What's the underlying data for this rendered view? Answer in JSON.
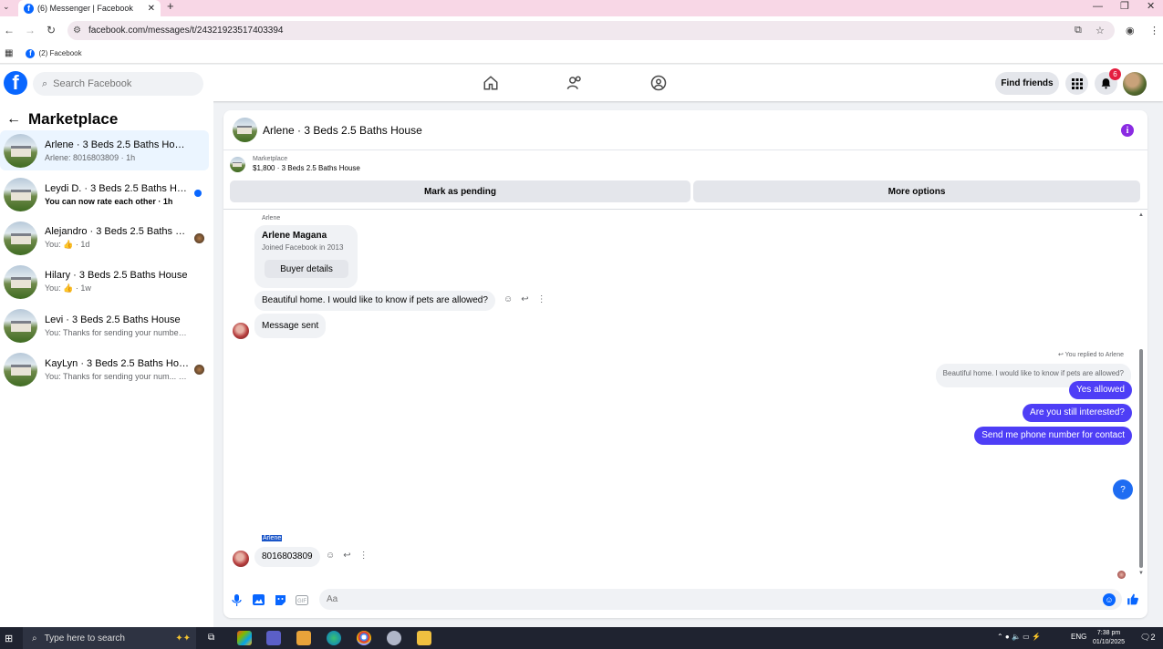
{
  "browser": {
    "tab_title": "(6) Messenger | Facebook",
    "url": "facebook.com/messages/t/24321923517403394",
    "bookmark": "(2) Facebook"
  },
  "header": {
    "search_placeholder": "Search Facebook",
    "find_friends": "Find friends",
    "notification_count": "6"
  },
  "sidebar": {
    "title": "Marketplace",
    "conversations": [
      {
        "name": "Arlene · 3 Beds 2.5 Baths House",
        "sub": "Arlene: 8016803809 · 1h",
        "active": true
      },
      {
        "name": "Leydi D. · 3 Beds 2.5 Baths House",
        "sub": "You can now rate each other · 1h",
        "unread": true
      },
      {
        "name": "Alejandro · 3 Beds 2.5 Baths Ho...",
        "sub": "You: 👍 · 1d"
      },
      {
        "name": "Hilary · 3 Beds 2.5 Baths House",
        "sub": "You: 👍 · 1w"
      },
      {
        "name": "Levi · 3 Beds 2.5 Baths House",
        "sub": "You: Thanks for sending your number,... · 1w"
      },
      {
        "name": "KayLyn · 3 Beds 2.5 Baths House",
        "sub": "You: Thanks for sending your num... · 1w"
      }
    ]
  },
  "chat": {
    "title": "Arlene · 3 Beds 2.5 Baths House",
    "listing_category": "Marketplace",
    "listing_line": "$1,800 · 3 Beds 2.5 Baths House",
    "mark_pending": "Mark as pending",
    "more_options": "More options",
    "sender": "Arlene",
    "card_name": "Arlene Magana",
    "card_sub": "Joined Facebook in 2013",
    "buyer_details": "Buyer details",
    "msg1": "Beautiful home. I would like to know if pets are allowed?",
    "msg2": "Message sent",
    "replied_label": "You replied to Arlene",
    "reply_quote": "Beautiful home. I would like to know if pets are allowed?",
    "out1": "Yes allowed",
    "out2": "Are you still interested?",
    "out3": "Send me phone number for contact",
    "q_mark": "?",
    "sender2": "Arlene",
    "msg3": "8016803809",
    "composer_placeholder": "Aa"
  },
  "taskbar": {
    "search": "Type here to search",
    "lang": "ENG",
    "time": "7:38 pm",
    "date": "01/10/2025",
    "notif": "2"
  }
}
